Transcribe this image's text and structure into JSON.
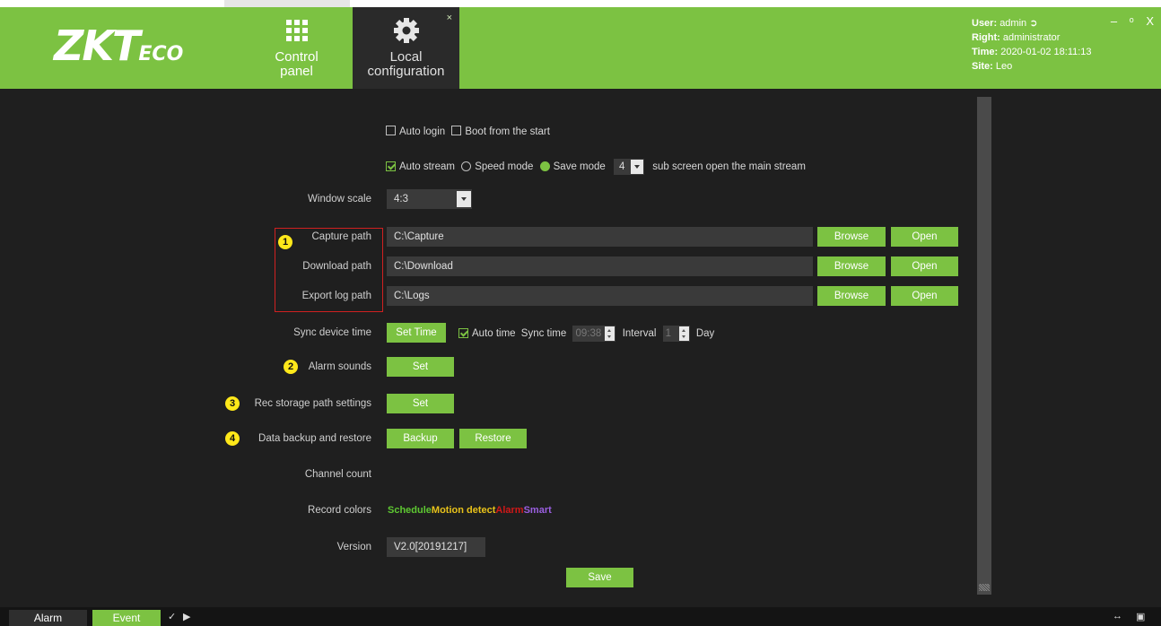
{
  "header": {
    "logo_main": "ZKT",
    "logo_small": "ECO",
    "tabs": [
      {
        "label_line1": "Control",
        "label_line2": "panel",
        "icon": "grid-icon"
      },
      {
        "label_line1": "Local",
        "label_line2": "configuration",
        "icon": "gear-icon",
        "close": "×"
      }
    ],
    "user": {
      "user_label": "User:",
      "user_value": "admin",
      "right_label": "Right:",
      "right_value": "administrator",
      "time_label": "Time:",
      "time_value": "2020-01-02 18:11:13",
      "site_label": "Site:",
      "site_value": "Leo"
    },
    "window_controls": {
      "minimize": "–",
      "restore": "ᵒ",
      "close": "X"
    }
  },
  "settings": {
    "auto_login": "Auto login",
    "boot_from_start": "Boot from the start",
    "auto_stream": "Auto stream",
    "speed_mode": "Speed mode",
    "save_mode": "Save mode",
    "sub_screen_count": "4",
    "sub_screen_text": "sub screen open the main stream",
    "window_scale_label": "Window scale",
    "window_scale_value": "4:3",
    "capture_path_label": "Capture path",
    "capture_path_value": "C:\\Capture",
    "download_path_label": "Download path",
    "download_path_value": "C:\\Download",
    "export_log_path_label": "Export log path",
    "export_log_path_value": "C:\\Logs",
    "browse": "Browse",
    "open": "Open",
    "sync_device_time_label": "Sync device time",
    "set_time": "Set Time",
    "auto_time": "Auto time",
    "sync_time_label": "Sync time",
    "sync_time_value": "09:38",
    "interval_label": "Interval",
    "interval_value": "1",
    "day_label": "Day",
    "alarm_sounds_label": "Alarm sounds",
    "set": "Set",
    "rec_storage_label": "Rec storage path settings",
    "data_backup_label": "Data backup and restore",
    "backup": "Backup",
    "restore": "Restore",
    "channel_count_label": "Channel count",
    "record_colors_label": "Record colors",
    "record_colors": [
      {
        "text": "Schedule",
        "color": "#5ec832"
      },
      {
        "text": "Motion detect",
        "color": "#e8c21a"
      },
      {
        "text": "Alarm",
        "color": "#d01818"
      },
      {
        "text": "Smart",
        "color": "#9a5fe0"
      }
    ],
    "version_label": "Version",
    "version_value": "V2.0[20191217]",
    "save": "Save"
  },
  "badges": [
    "1",
    "2",
    "3",
    "4"
  ],
  "footer": {
    "alarm": "Alarm",
    "event": "Event"
  },
  "colors": {
    "accent": "#7cc242",
    "background": "#1f1f1f",
    "field": "#3a3a3a",
    "highlight_box": "#d02020",
    "badge": "#ffe81a"
  }
}
